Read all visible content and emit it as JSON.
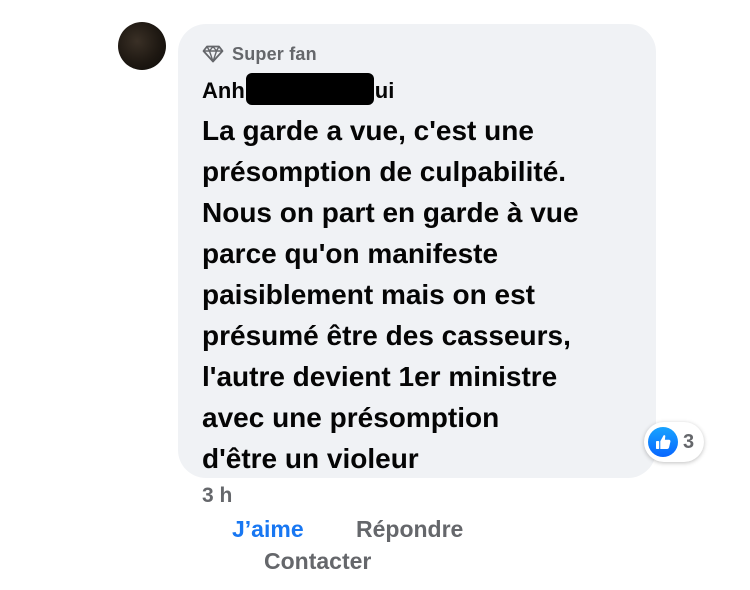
{
  "comment": {
    "badge": {
      "icon": "diamond-icon",
      "label": "Super fan"
    },
    "author": {
      "name_prefix": "Anh",
      "name_suffix": "ui"
    },
    "text": "La garde a vue, c'est une\nprésomption de culpabilité.\nNous on part en garde à vue\nparce qu'on manifeste\npaisiblement mais on est\nprésumé être des casseurs,\nl'autre devient 1er ministre\navec une présomption\nd'être un violeur",
    "reactions": {
      "icon": "like-icon",
      "count": "3"
    },
    "timestamp": "3 h"
  },
  "actions": {
    "like_label": "J’aime",
    "reply_label": "Répondre",
    "contact_label": "Contacter"
  },
  "colors": {
    "bubble_bg": "#f0f2f5",
    "secondary_text": "#65676b",
    "like_blue": "#1877f2"
  }
}
